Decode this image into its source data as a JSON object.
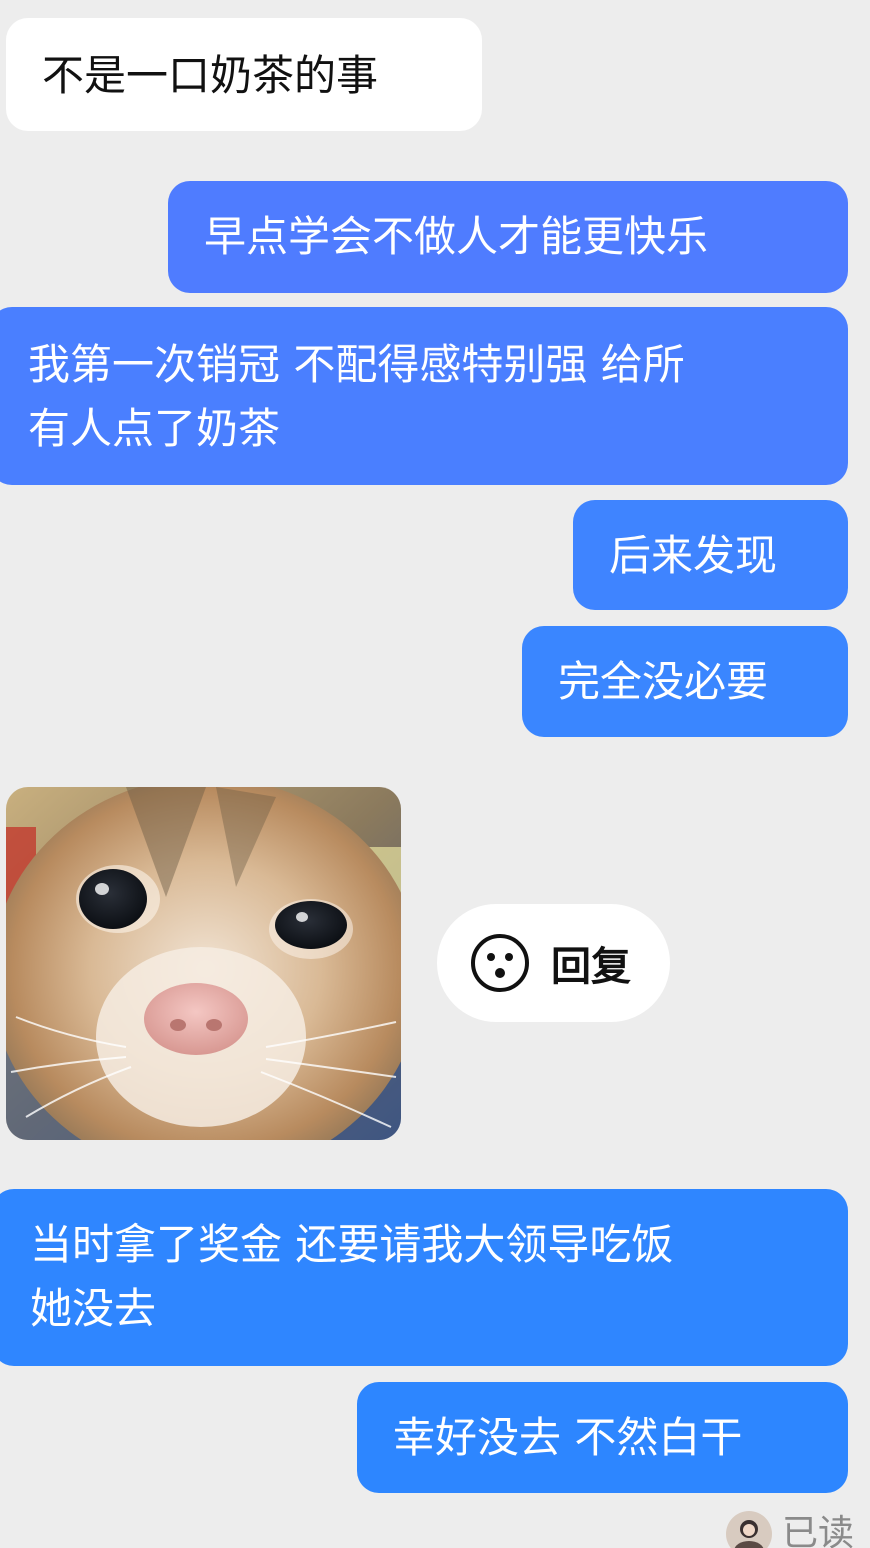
{
  "colors": {
    "background": "#ededed",
    "incoming_bubble": "#ffffff",
    "outgoing_blue_1": "#4f7cff",
    "outgoing_blue_2": "#2d86ff"
  },
  "messages": [
    {
      "side": "incoming",
      "text": "不是一口奶茶的事"
    },
    {
      "side": "outgoing",
      "text": "早点学会不做人才能更快乐"
    },
    {
      "side": "outgoing",
      "text_line1": "我第一次销冠 不配得感特别强 给所",
      "text_line2": "有人点了奶茶"
    },
    {
      "side": "outgoing",
      "text": "后来发现"
    },
    {
      "side": "outgoing",
      "text": "完全没必要"
    },
    {
      "side": "incoming",
      "type": "image",
      "image_icon": "kitten-photo"
    },
    {
      "side": "outgoing",
      "text_line1": "当时拿了奖金 还要请我大领导吃饭",
      "text_line2": "她没去"
    },
    {
      "side": "outgoing",
      "text": "幸好没去 不然白干"
    }
  ],
  "quick_reply": {
    "icon": "smiley-face-icon",
    "label": "回复"
  },
  "read_receipt": {
    "avatar_icon": "user-avatar",
    "label": "已读"
  }
}
